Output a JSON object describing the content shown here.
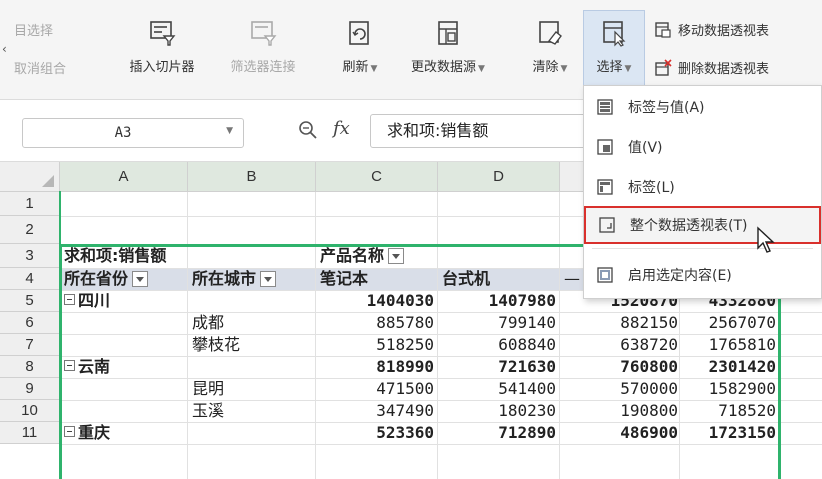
{
  "ribbon": {
    "left_top": "目选择",
    "left_bottom": "取消组合",
    "insert_slicer": "插入切片器",
    "filter_connection": "筛选器连接",
    "refresh": "刷新",
    "change_source": "更改数据源",
    "clear": "清除",
    "select": "选择",
    "move_pivot": "移动数据透视表",
    "delete_pivot": "删除数据透视表"
  },
  "menu": {
    "items": [
      {
        "label": "标签与值(A)"
      },
      {
        "label": "值(V)"
      },
      {
        "label": "标签(L)"
      },
      {
        "label": "整个数据透视表(T)"
      },
      {
        "label": "启用选定内容(E)"
      }
    ]
  },
  "formula_bar": {
    "name_box": "A3",
    "fx": "fx",
    "value": "求和项:销售额"
  },
  "sheet": {
    "columns": [
      "A",
      "B",
      "C",
      "D"
    ],
    "rows": [
      "1",
      "2",
      "3",
      "4",
      "5",
      "6",
      "7",
      "8",
      "9",
      "10",
      "11"
    ],
    "pivot": {
      "r3": {
        "a": "求和项:销售额",
        "c": "产品名称"
      },
      "r4": {
        "a": "所在省份",
        "b": "所在城市",
        "c": "笔记本",
        "d": "台式机",
        "e": "—"
      },
      "r5": {
        "a": "四川",
        "c": "1404030",
        "d": "1407980",
        "e": "1520870",
        "f": "4332880"
      },
      "r6": {
        "b": "成都",
        "c": "885780",
        "d": "799140",
        "e": "882150",
        "f": "2567070"
      },
      "r7": {
        "b": "攀枝花",
        "c": "518250",
        "d": "608840",
        "e": "638720",
        "f": "1765810"
      },
      "r8": {
        "a": "云南",
        "c": "818990",
        "d": "721630",
        "e": "760800",
        "f": "2301420"
      },
      "r9": {
        "b": "昆明",
        "c": "471500",
        "d": "541400",
        "e": "570000",
        "f": "1582900"
      },
      "r10": {
        "b": "玉溪",
        "c": "347490",
        "d": "180230",
        "e": "190800",
        "f": "718520"
      },
      "r11": {
        "a": "重庆",
        "c": "523360",
        "d": "712890",
        "e": "486900",
        "f": "1723150"
      }
    }
  },
  "colors": {
    "selection_green": "#2fb36c",
    "highlight_red": "#d9302c",
    "active_button": "#dbe6f3"
  }
}
